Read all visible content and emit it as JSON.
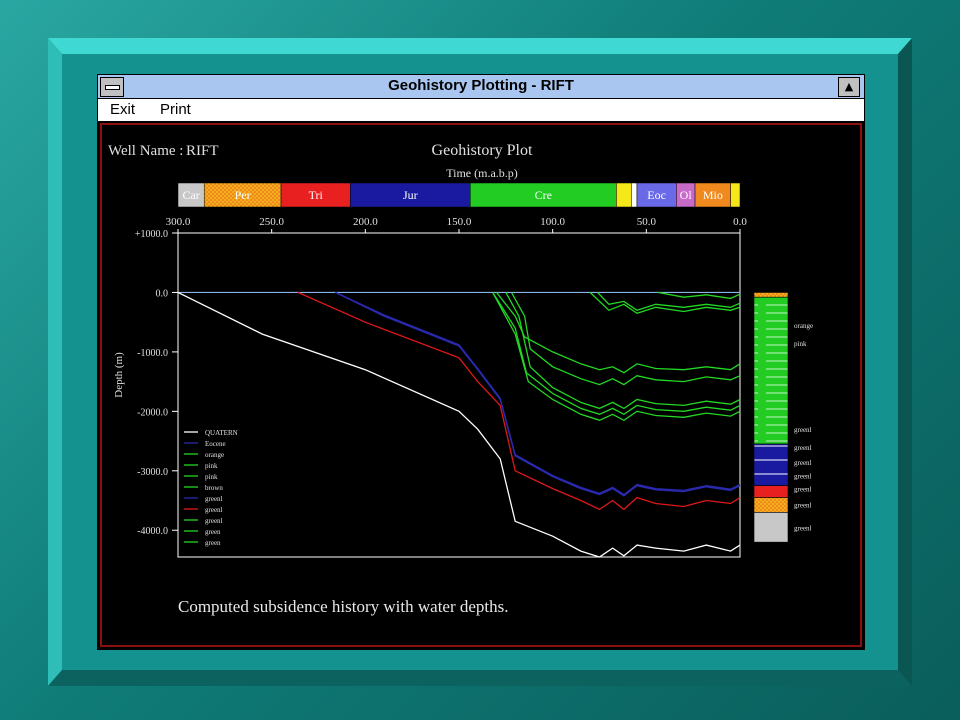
{
  "window": {
    "title": "Geohistory Plotting - RIFT",
    "menu": [
      "Exit",
      "Print"
    ]
  },
  "header": {
    "well_label": "Well Name :",
    "well_name": "RIFT",
    "plot_title": "Geohistory Plot",
    "time_label": "Time (m.a.b.p)"
  },
  "periods": [
    {
      "label": "Car",
      "start": 300,
      "end": 286,
      "color": "#c8c8c8",
      "text": "#ffffff",
      "pattern": "none"
    },
    {
      "label": "Per",
      "start": 286,
      "end": 245,
      "color": "#f08a1e",
      "text": "#ffffff",
      "pattern": "dots"
    },
    {
      "label": "Tri",
      "start": 245,
      "end": 208,
      "color": "#e82020",
      "text": "#ffffff",
      "pattern": "none"
    },
    {
      "label": "Jur",
      "start": 208,
      "end": 144,
      "color": "#1a1aa0",
      "text": "#ffffff",
      "pattern": "none"
    },
    {
      "label": "Cre",
      "start": 144,
      "end": 66,
      "color": "#22cc22",
      "text": "#ffffff",
      "pattern": "none"
    },
    {
      "label": "",
      "start": 66,
      "end": 58,
      "color": "#f4e818",
      "text": "#ffffff",
      "pattern": "none"
    },
    {
      "label": "",
      "start": 58,
      "end": 55,
      "color": "#ffffff",
      "text": "#ffffff",
      "pattern": "none"
    },
    {
      "label": "Eoc",
      "start": 55,
      "end": 34,
      "color": "#6a6ae8",
      "text": "#ffffff",
      "pattern": "none"
    },
    {
      "label": "Ol",
      "start": 34,
      "end": 24,
      "color": "#c86ac8",
      "text": "#ffffff",
      "pattern": "none"
    },
    {
      "label": "Mio",
      "start": 24,
      "end": 5,
      "color": "#f08a1e",
      "text": "#ffffff",
      "pattern": "none"
    },
    {
      "label": "",
      "start": 5,
      "end": 0,
      "color": "#f4e818",
      "text": "#ffffff",
      "pattern": "none"
    }
  ],
  "caption": "Computed subsidence history with water depths.",
  "colors": {
    "white": "#ffffff",
    "blue": "#2a2ab0",
    "green": "#22d822",
    "red": "#e01818",
    "waterline": "#8ab4e8"
  },
  "chart_data": {
    "type": "line",
    "title": "Geohistory Plot",
    "xlabel": "Time (m.a.b.p)",
    "ylabel": "Depth (m)",
    "xlim": [
      300,
      0
    ],
    "ylim": [
      1000,
      -4450
    ],
    "x_ticks": [
      "300.0",
      "250.0",
      "200.0",
      "150.0",
      "100.0",
      "50.0",
      "0.0"
    ],
    "x_tick_values": [
      300,
      250,
      200,
      150,
      100,
      50,
      0
    ],
    "y_ticks": [
      "+1000.0",
      "0.0",
      "-1000.0",
      "-2000.0",
      "-3000.0",
      "-4000.0"
    ],
    "y_tick_values": [
      1000,
      0,
      -1000,
      -2000,
      -3000,
      -4000
    ],
    "water_level": 0,
    "legend_position": "bottom-left",
    "series": [
      {
        "name": "QUATERN",
        "color": "white",
        "points": [
          [
            300,
            0
          ],
          [
            255,
            -700
          ],
          [
            200,
            -1300
          ],
          [
            150,
            -2000
          ],
          [
            140,
            -2300
          ],
          [
            128,
            -2800
          ],
          [
            120,
            -3850
          ],
          [
            100,
            -4100
          ],
          [
            85,
            -4350
          ],
          [
            75,
            -4450
          ],
          [
            68,
            -4300
          ],
          [
            62,
            -4430
          ],
          [
            55,
            -4250
          ],
          [
            45,
            -4300
          ],
          [
            30,
            -4350
          ],
          [
            18,
            -4250
          ],
          [
            5,
            -4350
          ],
          [
            0,
            -4250
          ]
        ]
      },
      {
        "name": "Eocene",
        "color": "blue",
        "points": [
          [
            216,
            0
          ],
          [
            190,
            -400
          ],
          [
            150,
            -900
          ],
          [
            140,
            -1300
          ],
          [
            128,
            -1800
          ],
          [
            120,
            -2750
          ],
          [
            100,
            -3100
          ],
          [
            85,
            -3300
          ],
          [
            75,
            -3400
          ],
          [
            68,
            -3300
          ],
          [
            62,
            -3420
          ],
          [
            55,
            -3250
          ],
          [
            45,
            -3320
          ],
          [
            30,
            -3350
          ],
          [
            18,
            -3270
          ],
          [
            5,
            -3330
          ],
          [
            0,
            -3250
          ]
        ]
      },
      {
        "name": "orange",
        "color": "green",
        "points": [
          [
            130,
            0
          ],
          [
            120,
            -400
          ],
          [
            115,
            -750
          ],
          [
            100,
            -1000
          ],
          [
            85,
            -1200
          ],
          [
            75,
            -1300
          ],
          [
            68,
            -1250
          ],
          [
            62,
            -1350
          ],
          [
            55,
            -1200
          ],
          [
            45,
            -1280
          ],
          [
            30,
            -1300
          ],
          [
            18,
            -1250
          ],
          [
            5,
            -1300
          ],
          [
            0,
            -1200
          ]
        ]
      },
      {
        "name": "pink",
        "color": "green",
        "points": [
          [
            122,
            0
          ],
          [
            115,
            -400
          ],
          [
            112,
            -950
          ],
          [
            100,
            -1250
          ],
          [
            85,
            -1450
          ],
          [
            75,
            -1550
          ],
          [
            68,
            -1450
          ],
          [
            62,
            -1550
          ],
          [
            55,
            -1400
          ],
          [
            45,
            -1470
          ],
          [
            30,
            -1500
          ],
          [
            18,
            -1420
          ],
          [
            5,
            -1470
          ],
          [
            0,
            -1400
          ]
        ]
      },
      {
        "name": "pink",
        "color": "green",
        "points": [
          [
            125,
            0
          ],
          [
            118,
            -400
          ],
          [
            112,
            -1250
          ],
          [
            100,
            -1600
          ],
          [
            85,
            -1850
          ],
          [
            75,
            -1950
          ],
          [
            68,
            -1850
          ],
          [
            62,
            -1950
          ],
          [
            55,
            -1800
          ],
          [
            45,
            -1870
          ],
          [
            30,
            -1900
          ],
          [
            18,
            -1830
          ],
          [
            5,
            -1880
          ],
          [
            0,
            -1800
          ]
        ]
      },
      {
        "name": "brown",
        "color": "green",
        "points": [
          [
            132,
            0
          ],
          [
            120,
            -600
          ],
          [
            114,
            -1350
          ],
          [
            100,
            -1700
          ],
          [
            85,
            -1950
          ],
          [
            75,
            -2050
          ],
          [
            68,
            -1950
          ],
          [
            62,
            -2050
          ],
          [
            55,
            -1900
          ],
          [
            45,
            -1970
          ],
          [
            30,
            -2000
          ],
          [
            18,
            -1930
          ],
          [
            5,
            -1980
          ],
          [
            0,
            -1900
          ]
        ]
      },
      {
        "name": "greenl",
        "color": "blue",
        "points": [
          [
            216,
            0
          ],
          [
            190,
            -380
          ],
          [
            150,
            -880
          ],
          [
            140,
            -1280
          ],
          [
            128,
            -1780
          ],
          [
            120,
            -2730
          ],
          [
            100,
            -3080
          ],
          [
            85,
            -3280
          ],
          [
            75,
            -3380
          ],
          [
            68,
            -3280
          ],
          [
            62,
            -3400
          ],
          [
            55,
            -3230
          ],
          [
            45,
            -3300
          ],
          [
            30,
            -3330
          ],
          [
            18,
            -3250
          ],
          [
            5,
            -3310
          ],
          [
            0,
            -3230
          ]
        ]
      },
      {
        "name": "greenl",
        "color": "red",
        "points": [
          [
            236,
            0
          ],
          [
            200,
            -500
          ],
          [
            150,
            -1100
          ],
          [
            140,
            -1500
          ],
          [
            128,
            -1900
          ],
          [
            120,
            -3000
          ],
          [
            100,
            -3300
          ],
          [
            85,
            -3500
          ],
          [
            75,
            -3650
          ],
          [
            68,
            -3500
          ],
          [
            62,
            -3650
          ],
          [
            55,
            -3450
          ],
          [
            45,
            -3550
          ],
          [
            30,
            -3600
          ],
          [
            18,
            -3500
          ],
          [
            5,
            -3550
          ],
          [
            0,
            -3450
          ]
        ]
      },
      {
        "name": "greenl",
        "color": "green",
        "points": [
          [
            132,
            0
          ],
          [
            120,
            -700
          ],
          [
            113,
            -1500
          ],
          [
            100,
            -1800
          ],
          [
            85,
            -2050
          ],
          [
            75,
            -2150
          ],
          [
            68,
            -2050
          ],
          [
            62,
            -2150
          ],
          [
            55,
            -2000
          ],
          [
            45,
            -2070
          ],
          [
            30,
            -2100
          ],
          [
            18,
            -2030
          ],
          [
            5,
            -2080
          ],
          [
            0,
            -2000
          ]
        ]
      },
      {
        "name": "green",
        "color": "green",
        "points": [
          [
            76,
            0
          ],
          [
            70,
            -200
          ],
          [
            62,
            -150
          ],
          [
            55,
            -300
          ],
          [
            45,
            -200
          ],
          [
            30,
            -250
          ],
          [
            18,
            -200
          ],
          [
            5,
            -250
          ],
          [
            0,
            -180
          ]
        ]
      },
      {
        "name": "green",
        "color": "green",
        "points": [
          [
            44,
            0
          ],
          [
            30,
            -80
          ],
          [
            18,
            -40
          ],
          [
            5,
            -100
          ],
          [
            0,
            -30
          ]
        ]
      },
      {
        "name": "green",
        "color": "green",
        "points": [
          [
            80,
            0
          ],
          [
            70,
            -300
          ],
          [
            62,
            -200
          ],
          [
            55,
            -350
          ],
          [
            45,
            -250
          ],
          [
            30,
            -320
          ],
          [
            18,
            -250
          ],
          [
            5,
            -300
          ],
          [
            0,
            -250
          ]
        ]
      }
    ],
    "lith_column": [
      {
        "color": "#f08a1e",
        "pattern": "dots",
        "from": 0,
        "to": -80,
        "label": ""
      },
      {
        "color": "#22cc22",
        "pattern": "dash",
        "from": -80,
        "to": -2550,
        "label": ""
      },
      {
        "color": "#1a1aa0",
        "pattern": "line",
        "from": -2550,
        "to": -3250,
        "label": ""
      },
      {
        "color": "#e82020",
        "pattern": "none",
        "from": -3250,
        "to": -3450,
        "label": ""
      },
      {
        "color": "#f08a1e",
        "pattern": "dots",
        "from": -3450,
        "to": -3700,
        "label": ""
      },
      {
        "color": "#c8c8c8",
        "pattern": "none",
        "from": -3700,
        "to": -4200,
        "label": ""
      }
    ],
    "lith_labels": [
      {
        "depth": -550,
        "text": "orange"
      },
      {
        "depth": -850,
        "text": "pink"
      },
      {
        "depth": -2300,
        "text": "greenl"
      },
      {
        "depth": -2600,
        "text": "greenl"
      },
      {
        "depth": -2850,
        "text": "greenl"
      },
      {
        "depth": -3080,
        "text": "greenl"
      },
      {
        "depth": -3300,
        "text": "greenl"
      },
      {
        "depth": -3570,
        "text": "greenl"
      },
      {
        "depth": -3950,
        "text": "greenl"
      }
    ],
    "legend": [
      "QUATERN",
      "Eocene",
      "orange",
      "pink",
      "pink",
      "brown",
      "greenl",
      "greenl",
      "greenl",
      "green",
      "green"
    ]
  }
}
